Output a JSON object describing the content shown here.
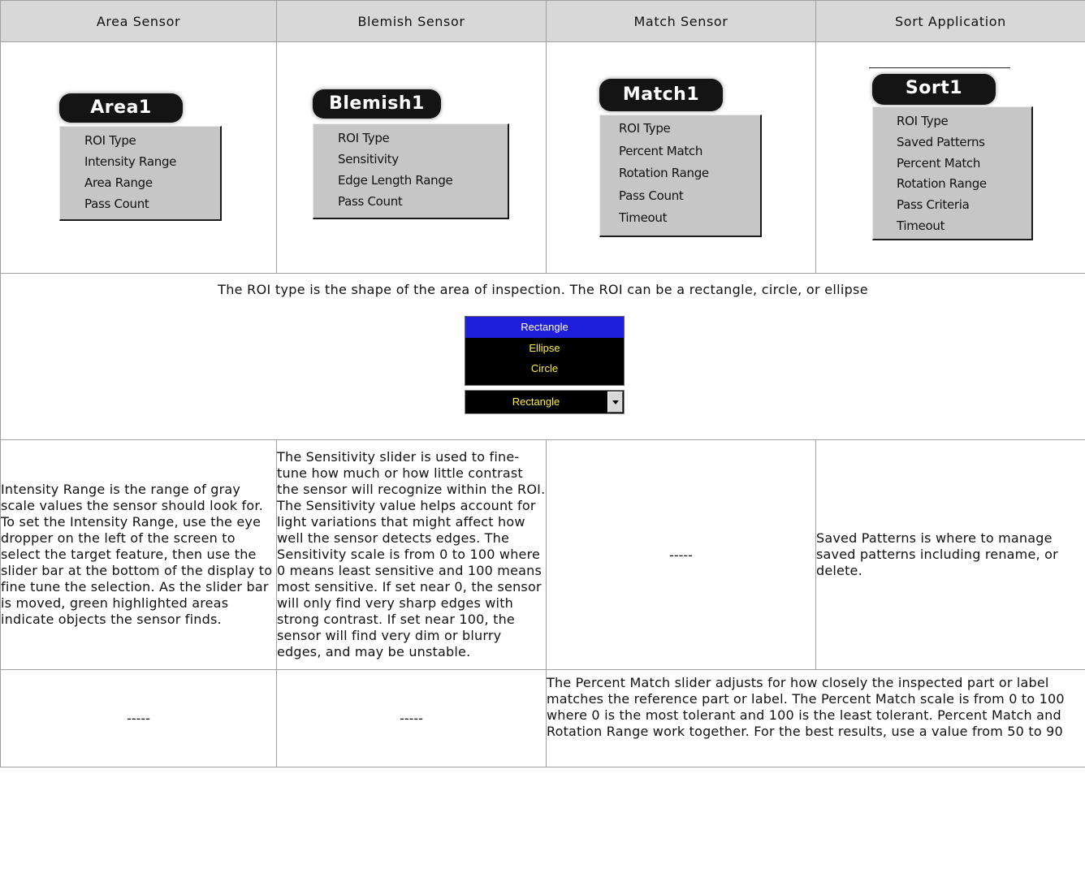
{
  "headers": [
    "Area Sensor",
    "Blemish Sensor",
    "Match Sensor",
    "Sort Application"
  ],
  "menus": {
    "area": {
      "title": "Area1",
      "items": [
        "ROI Type",
        "Intensity Range",
        "Area Range",
        "Pass Count"
      ]
    },
    "blemish": {
      "title": "Blemish1",
      "items": [
        "ROI Type",
        "Sensitivity",
        "Edge Length Range",
        "Pass Count"
      ]
    },
    "match": {
      "title": "Match1",
      "items": [
        "ROI Type",
        "Percent Match",
        "Rotation Range",
        "Pass Count",
        "Timeout"
      ]
    },
    "sort": {
      "title": "Sort1",
      "items": [
        "ROI Type",
        "Saved Patterns",
        "Percent Match",
        "Rotation Range",
        "Pass Criteria",
        "Timeout"
      ]
    }
  },
  "roi": {
    "text": "The ROI type is the shape of the area of inspection. The ROI can be a rectangle, circle, or ellipse",
    "options": [
      "Rectangle",
      "Ellipse",
      "Circle"
    ],
    "selected": "Rectangle"
  },
  "row3": {
    "area": "Intensity Range is the range of gray scale values the sensor should look for. To set the Intensity Range, use the eye dropper on the left of the screen to select the target feature, then use the slider bar at the bottom of the display to fine tune the selection. As the slider bar is moved, green highlighted areas indicate objects the sensor finds.",
    "blemish": "The Sensitivity slider is used to fine-tune how much or how little contrast the sensor will recognize within the ROI. The Sensitivity value helps account for light variations that might affect how well the sensor detects edges. The Sensitivity scale is from 0 to 100 where 0 means least sensitive and 100 means most sensitive. If set near 0, the sensor will only find very sharp edges with strong contrast. If set near 100, the sensor will find very dim or blurry edges, and may be unstable.",
    "match": "-----",
    "sort": "Saved Patterns is where to manage saved patterns including rename, or delete."
  },
  "row4": {
    "area": "-----",
    "blemish": "-----",
    "match_sort": "The Percent Match slider adjusts for how closely the inspected part or label matches the reference part or label. The Percent Match scale is from 0 to 100 where 0 is the most tolerant and 100 is the least tolerant. Percent Match and Rotation Range work together. For the best results, use a value from 50 to 90"
  }
}
